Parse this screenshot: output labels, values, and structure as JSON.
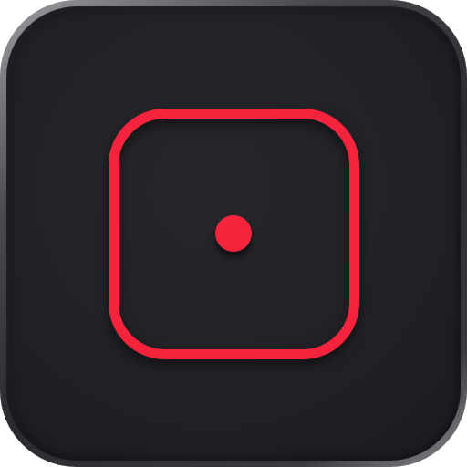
{
  "icon": {
    "semantic": "dice-face-one-icon",
    "pip_count": 1,
    "accent_color": "#f5243c",
    "background_color": "#232227",
    "bezel_color": "#6e6e72"
  }
}
